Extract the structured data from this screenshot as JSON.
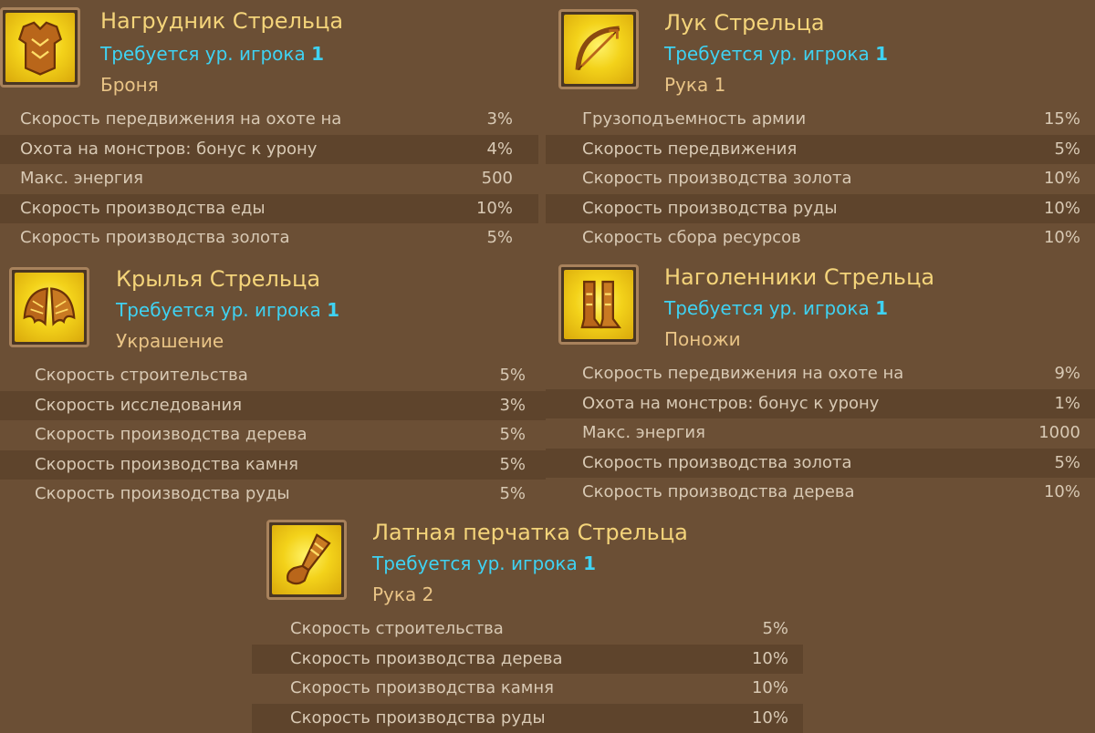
{
  "items": [
    {
      "title": "Нагрудник Стрельца",
      "req_text": "Требуется ур. игрока",
      "req_level": "1",
      "slot": "Броня",
      "icon": "chestplate-icon",
      "stats": [
        {
          "name": "Скорость передвижения на охоте на",
          "value": "3%"
        },
        {
          "name": "Охота на монстров: бонус к урону",
          "value": "4%"
        },
        {
          "name": "Макс. энергия",
          "value": "500"
        },
        {
          "name": "Скорость производства еды",
          "value": "10%"
        },
        {
          "name": "Скорость производства золота",
          "value": "5%"
        }
      ]
    },
    {
      "title": "Лук Стрельца",
      "req_text": "Требуется ур. игрока",
      "req_level": "1",
      "slot": "Рука 1",
      "icon": "bow-icon",
      "stats": [
        {
          "name": "Грузоподъемность армии",
          "value": "15%"
        },
        {
          "name": "Скорость передвижения",
          "value": "5%"
        },
        {
          "name": "Скорость производства золота",
          "value": "10%"
        },
        {
          "name": "Скорость производства руды",
          "value": "10%"
        },
        {
          "name": "Скорость сбора ресурсов",
          "value": "10%"
        }
      ]
    },
    {
      "title": "Крылья Стрельца",
      "req_text": "Требуется ур. игрока",
      "req_level": "1",
      "slot": "Украшение",
      "icon": "wings-icon",
      "stats": [
        {
          "name": "Скорость строительства",
          "value": "5%"
        },
        {
          "name": "Скорость исследования",
          "value": "3%"
        },
        {
          "name": "Скорость производства дерева",
          "value": "5%"
        },
        {
          "name": "Скорость производства камня",
          "value": "5%"
        },
        {
          "name": "Скорость производства руды",
          "value": "5%"
        }
      ]
    },
    {
      "title": "Наголенники Стрельца",
      "req_text": "Требуется ур. игрока",
      "req_level": "1",
      "slot": "Поножи",
      "icon": "greaves-icon",
      "stats": [
        {
          "name": "Скорость передвижения на охоте на",
          "value": "9%"
        },
        {
          "name": "Охота на монстров: бонус к урону",
          "value": "1%"
        },
        {
          "name": "Макс. энергия",
          "value": "1000"
        },
        {
          "name": "Скорость производства золота",
          "value": "5%"
        },
        {
          "name": "Скорость производства дерева",
          "value": "10%"
        }
      ]
    },
    {
      "title": "Латная перчатка Стрельца",
      "req_text": "Требуется ур. игрока",
      "req_level": "1",
      "slot": "Рука 2",
      "icon": "gauntlet-icon",
      "stats": [
        {
          "name": "Скорость строительства",
          "value": "5%"
        },
        {
          "name": "Скорость производства дерева",
          "value": "10%"
        },
        {
          "name": "Скорость производства камня",
          "value": "10%"
        },
        {
          "name": "Скорость производства руды",
          "value": "10%"
        }
      ]
    }
  ]
}
